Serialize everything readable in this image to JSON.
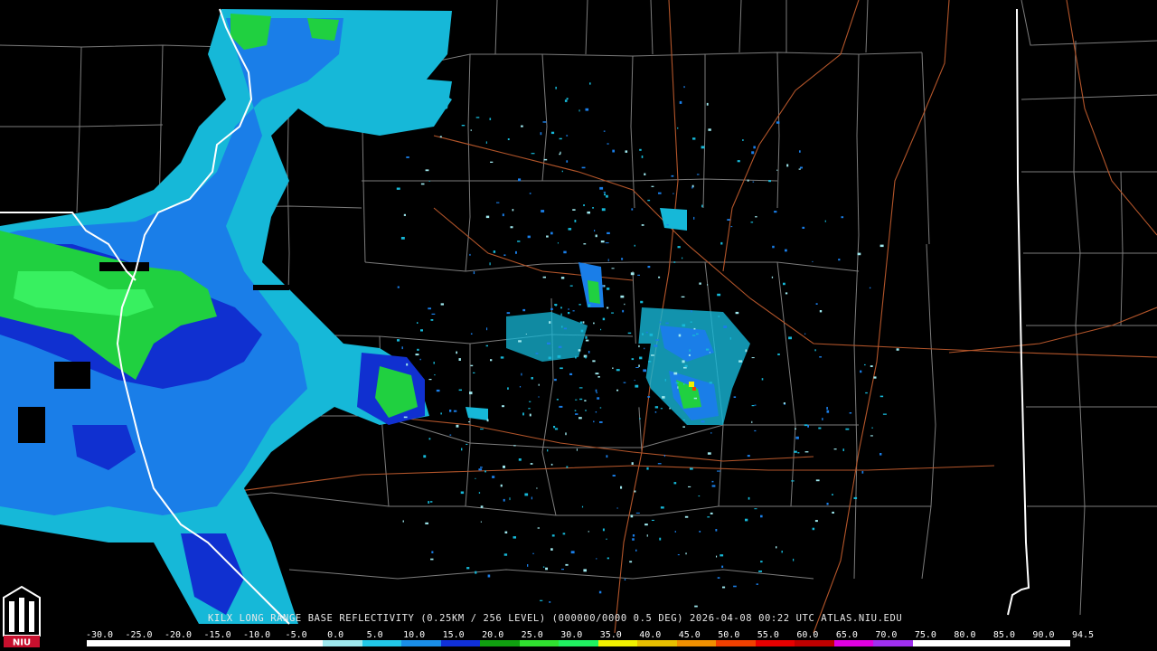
{
  "product_caption": "KILX LONG RANGE BASE REFLECTIVITY (0.25KM / 256 LEVEL) (000000/0000 0.5 DEG) 2026-04-08 00:22 UTC  ATLAS.NIU.EDU",
  "logo_text": "NIU",
  "colors": {
    "background": "#000000",
    "county_lines": "#8a8a8a",
    "state_border": "#ffffff",
    "highways": "#b3552a",
    "logo_red": "#c8102e"
  },
  "legend": {
    "labels": [
      "-30.0",
      "-25.0",
      "-20.0",
      "-15.0",
      "-10.0",
      "-5.0",
      "0.0",
      "5.0",
      "10.0",
      "15.0",
      "20.0",
      "25.0",
      "30.0",
      "35.0",
      "40.0",
      "45.0",
      "50.0",
      "55.0",
      "60.0",
      "65.0",
      "70.0",
      "75.0",
      "80.0",
      "85.0",
      "90.0",
      "94.5"
    ],
    "colors": [
      "#ffffff",
      "#ffffff",
      "#ffffff",
      "#ffffff",
      "#ffffff",
      "#ffffff",
      "#9ee8ee",
      "#22c8e8",
      "#1a8ee8",
      "#1030d8",
      "#10a010",
      "#30e030",
      "#20f060",
      "#f0f000",
      "#e8c000",
      "#f09000",
      "#f04000",
      "#e80000",
      "#c00000",
      "#e000e0",
      "#a030f0",
      "#ffffff",
      "#ffffff",
      "#ffffff",
      "#ffffff"
    ]
  }
}
